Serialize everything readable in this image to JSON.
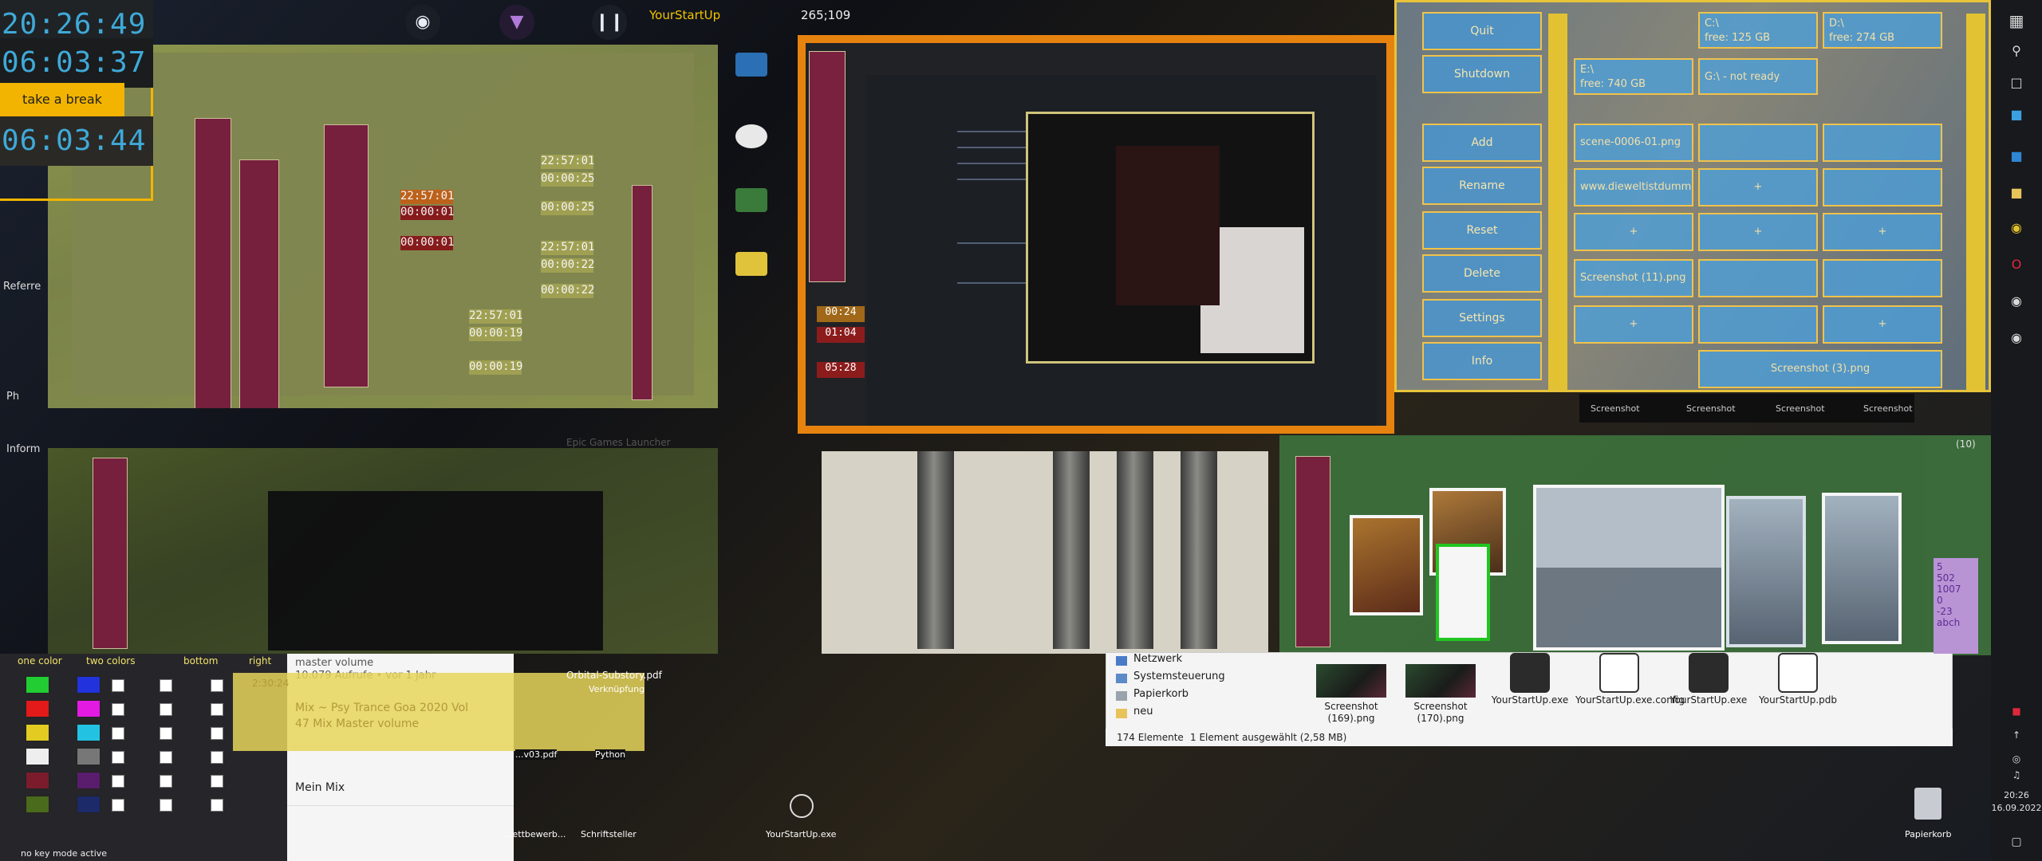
{
  "clocks": {
    "time_1": "20:26:49",
    "time_2": "06:03:37",
    "break_button": "take a break",
    "time_3": "06:03:44"
  },
  "topbar": {
    "app_label": "YourStartUp",
    "coordinates": "265;109"
  },
  "windows_mini_clocks": [
    "22:57:01",
    "00:00:01",
    "00:00:01",
    "22:57:01",
    "00:00:25",
    "00:00:25",
    "22:57:01",
    "00:00:22",
    "00:00:22",
    "22:57:01",
    "00:00:19",
    "00:00:19"
  ],
  "side_clocks": [
    "00:24",
    "01:04",
    "05:28"
  ],
  "launcher": {
    "buttons": [
      "Quit",
      "Shutdown",
      "Add",
      "Rename",
      "Reset",
      "Delete",
      "Settings",
      "Info"
    ],
    "drives": [
      {
        "label": "C:\\",
        "free": "free: 125 GB"
      },
      {
        "label": "D:\\",
        "free": "free: 274 GB"
      },
      {
        "label": "E:\\",
        "free": "free: 740 GB"
      },
      {
        "label": "G:\\ - not ready",
        "free": ""
      }
    ],
    "cells": [
      "scene-0006-01.png",
      "www.dieweltistdumm.de",
      "+",
      "+",
      "+",
      "+",
      "Screenshot (11).png",
      "+",
      "+",
      "Screenshot (3).png"
    ]
  },
  "taskbar_strip_labels": [
    "Screenshot",
    "Screenshot",
    "Screenshot",
    "Screenshot"
  ],
  "explorer": {
    "nav": [
      "Netzwerk",
      "Systemsteuerung",
      "Papierkorb",
      "neu"
    ],
    "files": [
      {
        "name": "Screenshot (169).png",
        "kind": "thumb"
      },
      {
        "name": "Screenshot (170).png",
        "kind": "thumb"
      },
      {
        "name": "YourStartUp.exe",
        "kind": "exe"
      },
      {
        "name": "YourStartUp.exe.config",
        "kind": "config"
      },
      {
        "name": "YourStartUp.exe",
        "kind": "exe"
      },
      {
        "name": "YourStartUp.pdb",
        "kind": "pdb"
      }
    ],
    "count": "174 Elemente",
    "selection": "1 Element ausgewählt (2,58 MB)"
  },
  "color_panel": {
    "options": [
      "one color",
      "two colors",
      "bottom",
      "right"
    ],
    "footer": "no key mode active"
  },
  "mix_panel": {
    "title": "master volume",
    "subtitle": "10.079 Aufrufe • vor 1 Jahr",
    "song_line_1": "Mix ~ Psy Trance Goa 2020 Vol",
    "song_line_2": "47 Mix Master volume",
    "song_line_3": "Mein Mix",
    "time_small": "2:30:24"
  },
  "desktop_icons": {
    "pdf": "Orbital-Substory.pdf",
    "verknuepfung": "Verknüpfung",
    "file_1": "...v03.pdf",
    "python": "Python",
    "bewerb": "...ettbewerb...",
    "schrift": "Schriftsteller",
    "exe_bottom": "YourStartUp.exe",
    "recycle": "Papierkorb"
  },
  "side_labels": {
    "refer": "Referre",
    "ph": "Ph",
    "inform": "Inform",
    "epic": "Epic Games Launcher"
  },
  "right_strip_numbers": [
    "5",
    "502",
    "1007",
    "0",
    "-23",
    "abch"
  ],
  "taskbar": {
    "time": "20:26",
    "date": "16.09.2022",
    "paren": "(10)"
  },
  "colors": {
    "accent_yellow": "#f2b400",
    "clock_blue": "#3fa9d8",
    "launcher_blue": "#4896d2",
    "mini_button": "#7b2140"
  }
}
